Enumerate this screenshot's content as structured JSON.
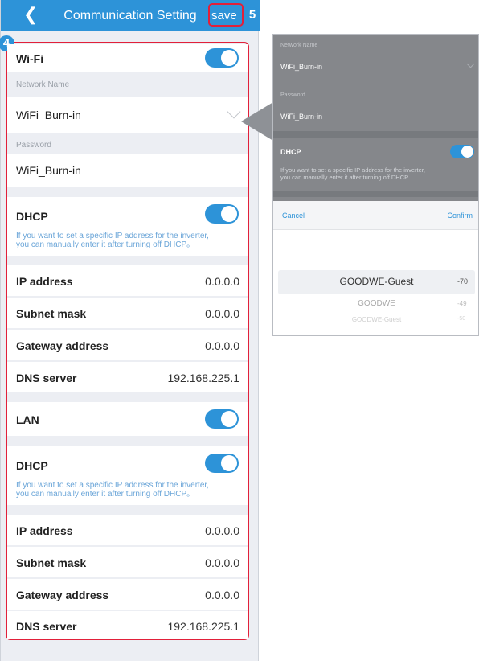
{
  "header": {
    "back_icon": "chevron-left-icon",
    "title": "Communication Setting",
    "save_label": "save"
  },
  "badges": {
    "save_badge": "5",
    "frame_badge": "4"
  },
  "wifi": {
    "label": "Wi-Fi",
    "enabled": true,
    "network_name_label": "Network Name",
    "network_name_value": "WiFi_Burn-in",
    "password_label": "Password",
    "password_value": "WiFi_Burn-in",
    "dhcp_label": "DHCP",
    "dhcp_enabled": true,
    "dhcp_hint_1": "If you want to set a specific IP address for the inverter,",
    "dhcp_hint_2": "you can manually enter it after turning off DHCP。",
    "fields": [
      {
        "label": "IP address",
        "value": "0.0.0.0"
      },
      {
        "label": "Subnet mask",
        "value": "0.0.0.0"
      },
      {
        "label": "Gateway address",
        "value": "0.0.0.0"
      },
      {
        "label": "DNS server",
        "value": "192.168.225.1"
      }
    ]
  },
  "lan": {
    "label": "LAN",
    "enabled": true,
    "dhcp_label": "DHCP",
    "dhcp_enabled": true,
    "dhcp_hint_1": "If you want to set a specific IP address for the inverter,",
    "dhcp_hint_2": "you can manually enter it after turning off DHCP。",
    "fields": [
      {
        "label": "IP address",
        "value": "0.0.0.0"
      },
      {
        "label": "Subnet mask",
        "value": "0.0.0.0"
      },
      {
        "label": "Gateway address",
        "value": "0.0.0.0"
      },
      {
        "label": "DNS server",
        "value": "192.168.225.1"
      }
    ]
  },
  "popup": {
    "network_name_label": "Network Name",
    "network_name_value": "WiFi_Burn-in",
    "password_label": "Password",
    "password_value": "WiFi_Burn-in",
    "dhcp_label": "DHCP",
    "dhcp_hint_1": "If you want to set a specific IP address for the inverter,",
    "dhcp_hint_2": "you can manually enter it after turning off DHCP",
    "cancel_label": "Cancel",
    "confirm_label": "Confirm",
    "networks": [
      {
        "name": "GOODWE-Guest",
        "signal": "-70"
      },
      {
        "name": "GOODWE",
        "signal": "-49"
      },
      {
        "name": "GOODWE-Guest",
        "signal": "-50"
      }
    ]
  },
  "colors": {
    "accent": "#2d93d8",
    "highlight": "#e2203a",
    "background": "#eceef3"
  }
}
